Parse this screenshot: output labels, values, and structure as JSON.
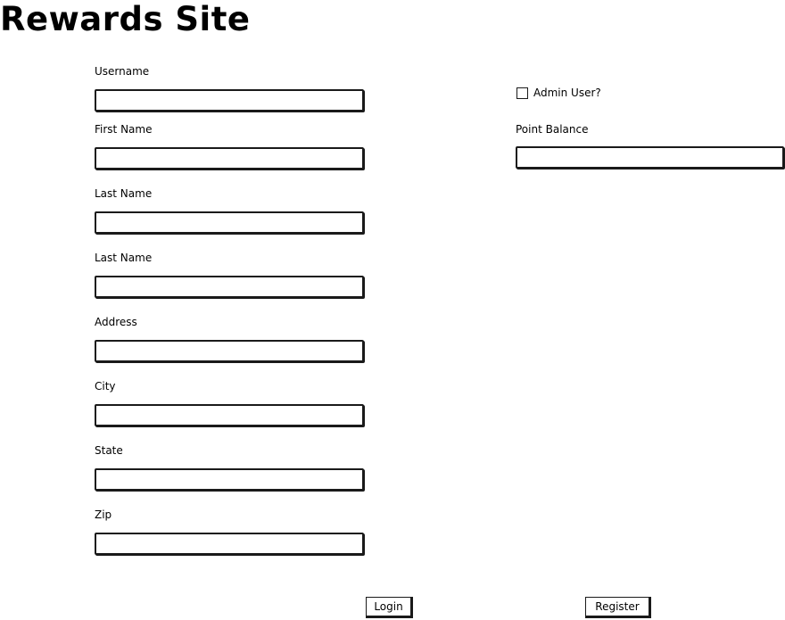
{
  "title": "Rewards Site",
  "form": {
    "username_label": "Username",
    "username_value": "",
    "first_name_label": "First Name",
    "first_name_value": "",
    "last_name_label": "Last Name",
    "last_name_value": "",
    "last_name_2_label": "Last Name",
    "last_name_2_value": "",
    "address_label": "Address",
    "address_value": "",
    "city_label": "City",
    "city_value": "",
    "state_label": "State",
    "state_value": "",
    "zip_label": "Zip",
    "zip_value": "",
    "admin_label": "Admin User?",
    "admin_checked": false,
    "point_balance_label": "Point Balance",
    "point_balance_value": ""
  },
  "actions": {
    "login_label": "Login",
    "register_label": "Register"
  }
}
